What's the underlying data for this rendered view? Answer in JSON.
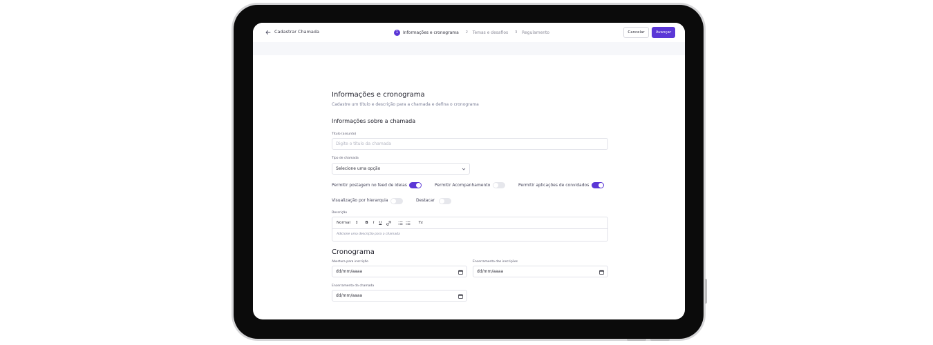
{
  "header": {
    "back_label": "Cadastrar Chamada",
    "steps": [
      {
        "num": "1",
        "label": "Informações e cronograma"
      },
      {
        "num": "2",
        "label": "Temas e desafios"
      },
      {
        "num": "3",
        "label": "Regulamento"
      }
    ],
    "cancel_label": "Cancelar",
    "next_label": "Avançar"
  },
  "form": {
    "title": "Informações e cronograma",
    "subtitle": "Cadastre um título e descrição para a chamada e defina o cronograma",
    "section_title": "Informações sobre a chamada",
    "title_field": {
      "label": "Título (assunto)",
      "placeholder": "Digite o título da chamada"
    },
    "type_field": {
      "label": "Tipo de chamada",
      "value": "Selecione uma opção"
    },
    "toggles": [
      {
        "label": "Permitir postagem no feed de ideias",
        "on": true
      },
      {
        "label": "Permitir Acompanhamento",
        "on": false
      },
      {
        "label": "Permitir aplicações de convidados",
        "on": true
      },
      {
        "label": "Visualização por hierarquia",
        "on": false
      },
      {
        "label": "Destacar",
        "on": false
      }
    ],
    "description": {
      "label": "Descrição",
      "toolbar": {
        "format": "Normal",
        "bold": "B",
        "italic": "I",
        "underline": "U",
        "clean": "Tx"
      },
      "placeholder": "Adicione uma descrição para a chamada"
    },
    "schedule": {
      "title": "Cronograma",
      "opening": {
        "label": "Abertura para inscrição",
        "value": "dd/mm/aaaa"
      },
      "closing_registrations": {
        "label": "Encerramento das inscrições",
        "value": "dd/mm/aaaa"
      },
      "closing_call": {
        "label": "Encerramento da chamada",
        "value": "dd/mm/aaaa"
      }
    }
  },
  "colors": {
    "accent": "#5b37d6",
    "toggle_off": "#e6e7ec"
  }
}
